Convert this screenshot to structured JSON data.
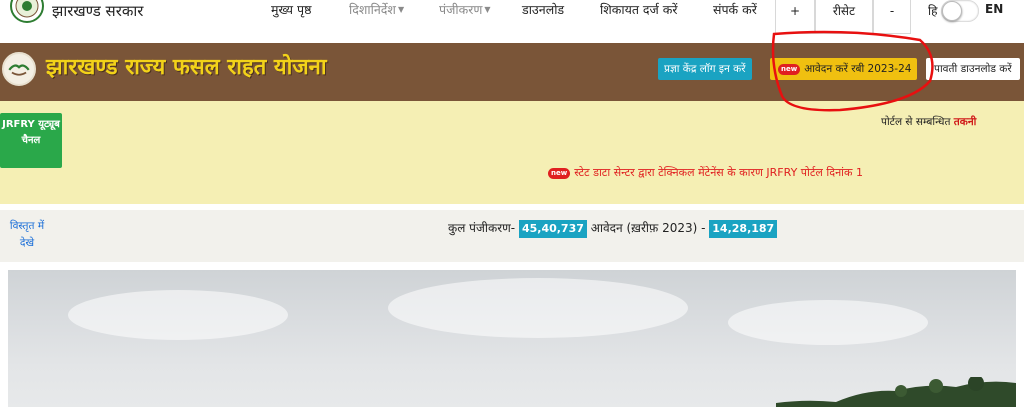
{
  "header": {
    "site_title": "झारखण्ड सरकार",
    "nav": {
      "home": "मुख्य पृष्ठ",
      "guidelines": "दिशानिर्देश",
      "registration": "पंजीकरण",
      "download": "डाउनलोड",
      "complaint": "शिकायत दर्ज करें",
      "contact": "संपर्क करें"
    },
    "zoom": {
      "increase": "+",
      "reset": "रीसेट",
      "decrease": "-"
    },
    "lang": {
      "hindi": "हि",
      "english": "EN"
    }
  },
  "banner": {
    "title": "झारखण्ड राज्य फसल राहत योजना",
    "portal_login": "प्रज्ञा केंद्र लॉग इन करें",
    "new_badge": "new",
    "apply_button": "आवेदन करें रबी 2023-24",
    "receipt_download": "पावती डाउनलोड करें"
  },
  "info": {
    "youtube_button": "JRFRY यूट्यूब चैनल",
    "support_text": "पोर्टल से सम्बन्धित ",
    "support_link": "तकनी",
    "ticker_badge": "new",
    "ticker_text": "स्टेट डाटा सेन्टर द्वारा टेक्निकल मेंटेनेंस के कारण JRFRY पोर्टल दिनांक 1"
  },
  "stats": {
    "details_link": "विस्तृत में देखे",
    "registration_label": "कुल पंजीकरण-",
    "registration_count": "45,40,737",
    "application_label": "आवेदन (ख़रीफ़ 2023) -",
    "application_count": "14,28,187"
  },
  "colors": {
    "banner_bg": "#7a5538",
    "banner_title": "#f2d219",
    "info_bg": "#f5efb4",
    "teal": "#1aa3c2",
    "yellow_btn": "#f0c010",
    "green_btn": "#2aa84a",
    "alert_red": "#e02020"
  }
}
